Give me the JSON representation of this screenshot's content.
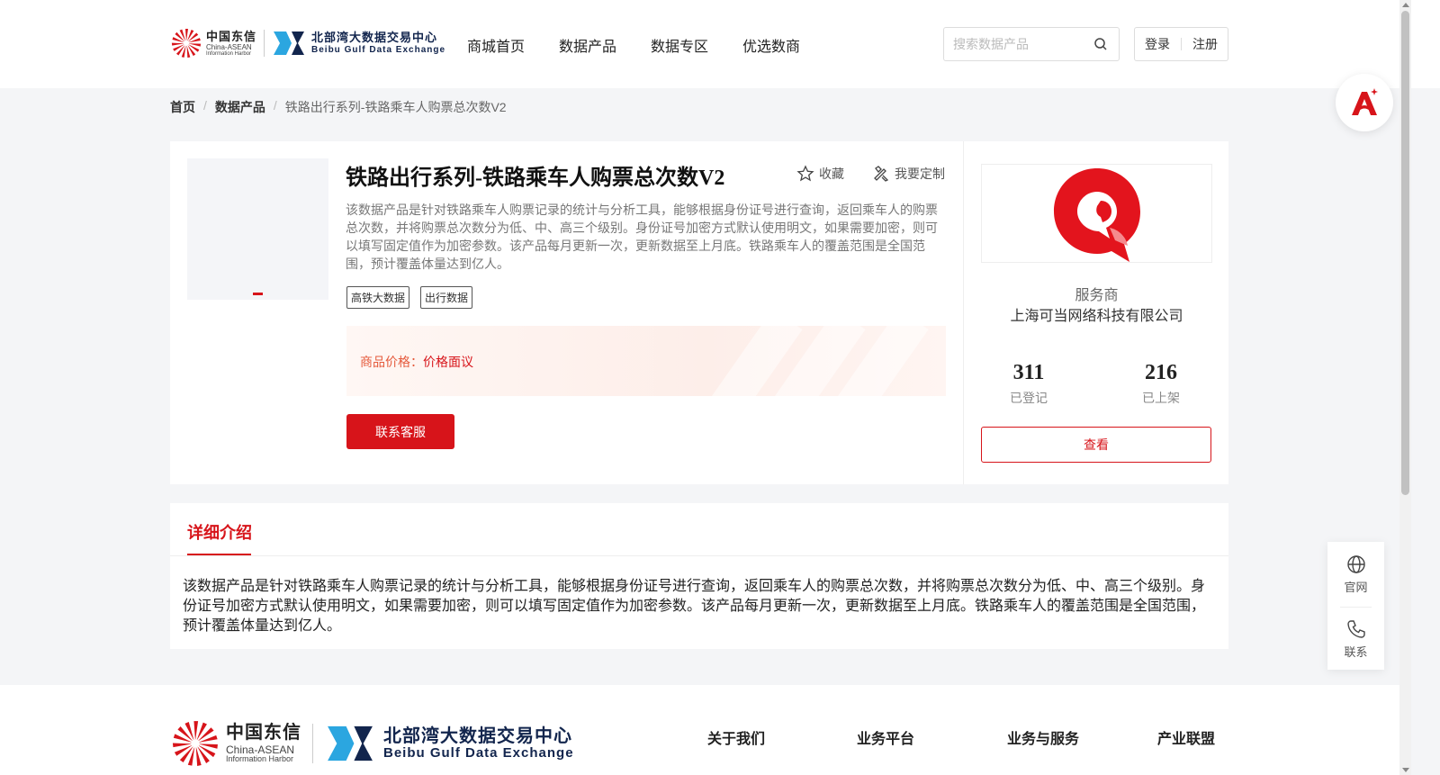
{
  "header": {
    "logo1_cn": "中国东信",
    "logo1_en1": "China-ASEAN",
    "logo1_en2": "Information Harbor",
    "logo2_cn": "北部湾大数据交易中心",
    "logo2_en": "Beibu Gulf Data Exchange",
    "nav": [
      "商城首页",
      "数据产品",
      "数据专区",
      "优选数商"
    ],
    "search_placeholder": "搜索数据产品",
    "login": "登录",
    "register": "注册"
  },
  "breadcrumb": [
    "首页",
    "数据产品",
    "铁路出行系列-铁路乘车人购票总次数V2"
  ],
  "product": {
    "title": "铁路出行系列-铁路乘车人购票总次数V2",
    "favorite": "收藏",
    "customize": "我要定制",
    "description": "该数据产品是针对铁路乘车人购票记录的统计与分析工具，能够根据身份证号进行查询，返回乘车人的购票总次数，并将购票总次数分为低、中、高三个级别。身份证号加密方式默认使用明文，如果需要加密，则可以填写固定值作为加密参数。该产品每月更新一次，更新数据至上月底。铁路乘车人的覆盖范围是全国范围，预计覆盖体量达到亿人。",
    "tags": [
      "高铁大数据",
      "出行数据"
    ],
    "price_label": "商品价格：",
    "price_value": "价格面议",
    "contact_button": "联系客服"
  },
  "provider": {
    "label": "服务商",
    "name": "上海可当网络科技有限公司",
    "stats": [
      {
        "value": "311",
        "label": "已登记"
      },
      {
        "value": "216",
        "label": "已上架"
      }
    ],
    "view_button": "查看"
  },
  "detail": {
    "tab": "详细介绍",
    "text": "该数据产品是针对铁路乘车人购票记录的统计与分析工具，能够根据身份证号进行查询，返回乘车人的购票总次数，并将购票总次数分为低、中、高三个级别。身份证号加密方式默认使用明文，如果需要加密，则可以填写固定值作为加密参数。该产品每月更新一次，更新数据至上月底。铁路乘车人的覆盖范围是全国范围，预计覆盖体量达到亿人。"
  },
  "side": {
    "website": "官网",
    "contact": "联系"
  },
  "footer": {
    "nav": [
      "关于我们",
      "业务平台",
      "业务与服务",
      "产业联盟"
    ]
  },
  "colors": {
    "brand_red": "#d7141a",
    "navy": "#12254d"
  }
}
